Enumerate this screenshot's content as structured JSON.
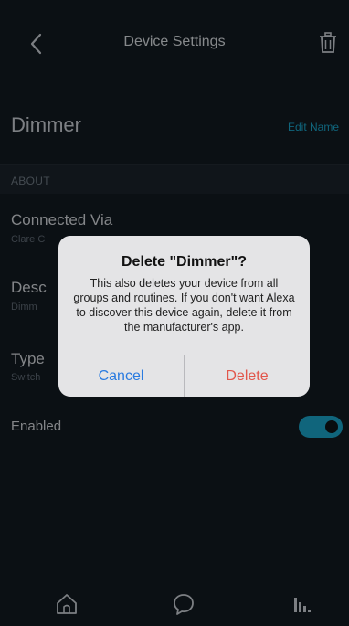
{
  "header": {
    "title": "Device Settings"
  },
  "device": {
    "name": "Dimmer",
    "edit_label": "Edit Name"
  },
  "about": {
    "section_label": "ABOUT",
    "connected_via": {
      "title": "Connected Via",
      "value": "Clare C"
    },
    "description": {
      "title": "Desc",
      "value": "Dimm"
    },
    "type": {
      "title": "Type",
      "value": "Switch"
    }
  },
  "enabled": {
    "label": "Enabled",
    "state": true
  },
  "tabbar": {
    "items": [
      "home-icon",
      "chat-icon",
      "devices-icon"
    ]
  },
  "dialog": {
    "title": "Delete \"Dimmer\"?",
    "message": "This also deletes your device from all groups and routines. If you don't want Alexa to discover this device again, delete it from the manufacturer's app.",
    "cancel_label": "Cancel",
    "delete_label": "Delete"
  },
  "colors": {
    "accent": "#1aa4c9",
    "background": "#131a21",
    "destructive": "#e2564b",
    "ios_blue": "#2a7be0"
  }
}
